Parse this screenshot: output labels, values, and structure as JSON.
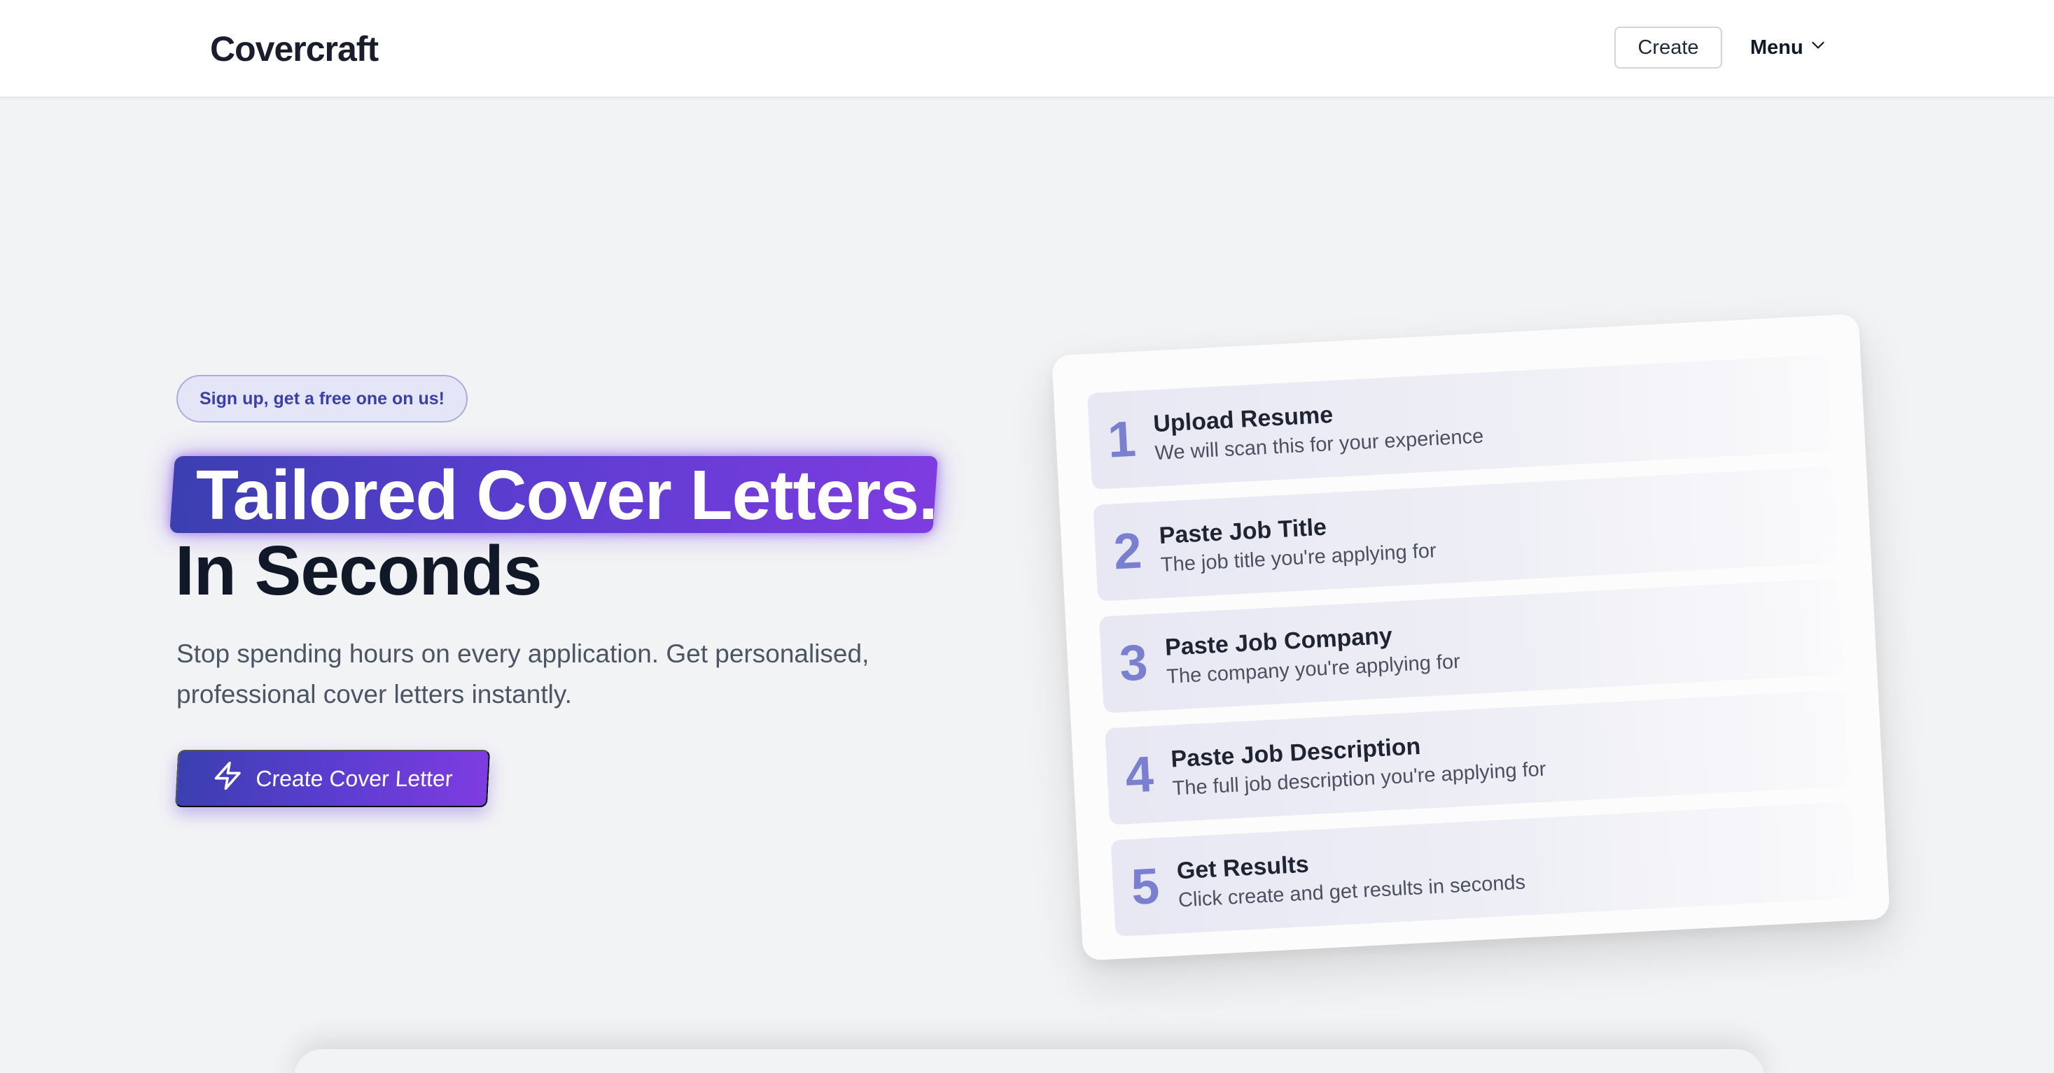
{
  "header": {
    "logo": "Covercraft",
    "create_label": "Create",
    "menu_label": "Menu"
  },
  "hero": {
    "badge": "Sign up, get a free one on us!",
    "headline_highlight": "Tailored Cover Letters.",
    "headline_rest": "In Seconds",
    "subtitle": "Stop spending hours on every application. Get personalised, professional cover letters instantly.",
    "cta_label": "Create Cover Letter"
  },
  "steps": [
    {
      "number": "1",
      "title": "Upload Resume",
      "description": "We will scan this for your experience"
    },
    {
      "number": "2",
      "title": "Paste Job Title",
      "description": "The job title you're applying for"
    },
    {
      "number": "3",
      "title": "Paste Job Company",
      "description": "The company you're applying for"
    },
    {
      "number": "4",
      "title": "Paste Job Description",
      "description": "The full job description you're applying for"
    },
    {
      "number": "5",
      "title": "Get Results",
      "description": "Click create and get results in seconds"
    }
  ],
  "icons": {
    "menu": "chevron-down-icon",
    "cta": "lightning-bolt-icon"
  },
  "colors": {
    "accent_start": "#3b3fb0",
    "accent_end": "#7e3ce0",
    "step_number": "#7b7fcf",
    "background": "#f2f3f5"
  }
}
